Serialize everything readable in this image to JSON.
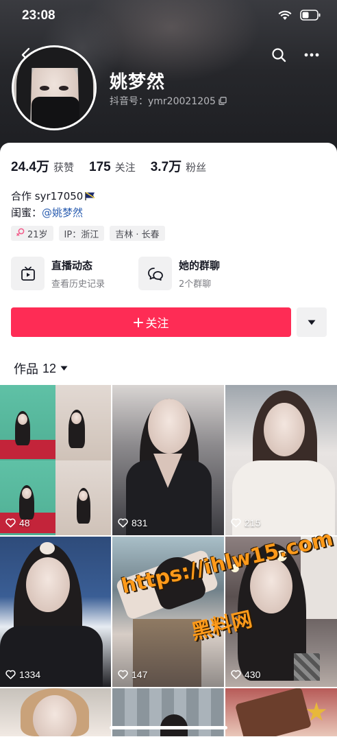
{
  "status_bar": {
    "time": "23:08"
  },
  "profile": {
    "name": "姚梦然",
    "douyin_id": "抖音号：ymr20021205"
  },
  "stats": [
    {
      "value": "24.4万",
      "label": "获赞"
    },
    {
      "value": "175",
      "label": "关注"
    },
    {
      "value": "3.7万",
      "label": "粉丝"
    }
  ],
  "bio": {
    "line1": "合作 syr17050",
    "line2_prefix": "闺蜜：",
    "line2_link": "@姚梦然"
  },
  "tags": [
    {
      "text": "21岁",
      "icon": "female-icon"
    },
    {
      "text": "IP：浙江"
    },
    {
      "text": "吉林 · 长春"
    }
  ],
  "features": [
    {
      "title": "直播动态",
      "subtitle": "查看历史记录",
      "icon": "live-tv-icon"
    },
    {
      "title": "她的群聊",
      "subtitle": "2个群聊",
      "icon": "group-chat-icon"
    }
  ],
  "follow_button": {
    "label": "关注"
  },
  "works_tab": {
    "label": "作品",
    "count": "12"
  },
  "videos": [
    {
      "likes": "48"
    },
    {
      "likes": "831"
    },
    {
      "likes": "215"
    },
    {
      "likes": "1334"
    },
    {
      "likes": "147"
    },
    {
      "likes": "430"
    }
  ],
  "watermark": {
    "url": "https://ihlw15.com",
    "text": "黑料网"
  },
  "colors": {
    "accent": "#fe2c55",
    "link": "#2a5db0",
    "watermark": "#ff9a1a"
  }
}
